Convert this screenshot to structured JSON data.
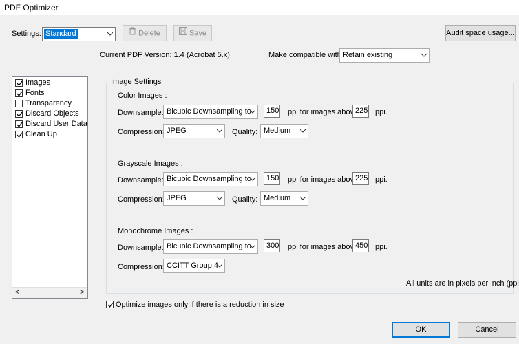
{
  "window": {
    "title": "PDF Optimizer"
  },
  "header": {
    "settings_label": "Settings:",
    "settings_value": "Standard",
    "delete_label": "Delete",
    "save_label": "Save",
    "audit_label": "Audit space usage...",
    "current_version": "Current PDF Version: 1.4 (Acrobat 5.x)",
    "compat_label": "Make compatible with:",
    "compat_value": "Retain existing"
  },
  "sidebar": {
    "items": [
      {
        "label": "Images",
        "checked": true
      },
      {
        "label": "Fonts",
        "checked": true
      },
      {
        "label": "Transparency",
        "checked": false
      },
      {
        "label": "Discard Objects",
        "checked": true
      },
      {
        "label": "Discard User Data",
        "checked": true
      },
      {
        "label": "Clean Up",
        "checked": true
      }
    ],
    "scroll_left": "<",
    "scroll_right": ">"
  },
  "image_settings": {
    "group_title": "Image Settings",
    "downsample_label": "Downsample:",
    "compression_label": "Compression:",
    "quality_label": "Quality:",
    "ppi_above_label": "ppi for images above",
    "ppi_label": "ppi.",
    "color": {
      "title": "Color Images :",
      "downsample": "Bicubic Downsampling to",
      "ppi": "150",
      "above": "225",
      "compression": "JPEG",
      "quality": "Medium"
    },
    "grayscale": {
      "title": "Grayscale Images :",
      "downsample": "Bicubic Downsampling to",
      "ppi": "150",
      "above": "225",
      "compression": "JPEG",
      "quality": "Medium"
    },
    "mono": {
      "title": "Monochrome Images :",
      "downsample": "Bicubic Downsampling to",
      "ppi": "300",
      "above": "450",
      "compression": "CCITT Group 4"
    },
    "units_note": "All units are in pixels per inch (ppi)."
  },
  "footer": {
    "optimize_label": "Optimize images only if there is a reduction in size",
    "optimize_checked": true,
    "ok_label": "OK",
    "cancel_label": "Cancel"
  },
  "colors": {
    "selection": "#0078d7",
    "border": "#adadad",
    "background": "#f0f0f0"
  }
}
